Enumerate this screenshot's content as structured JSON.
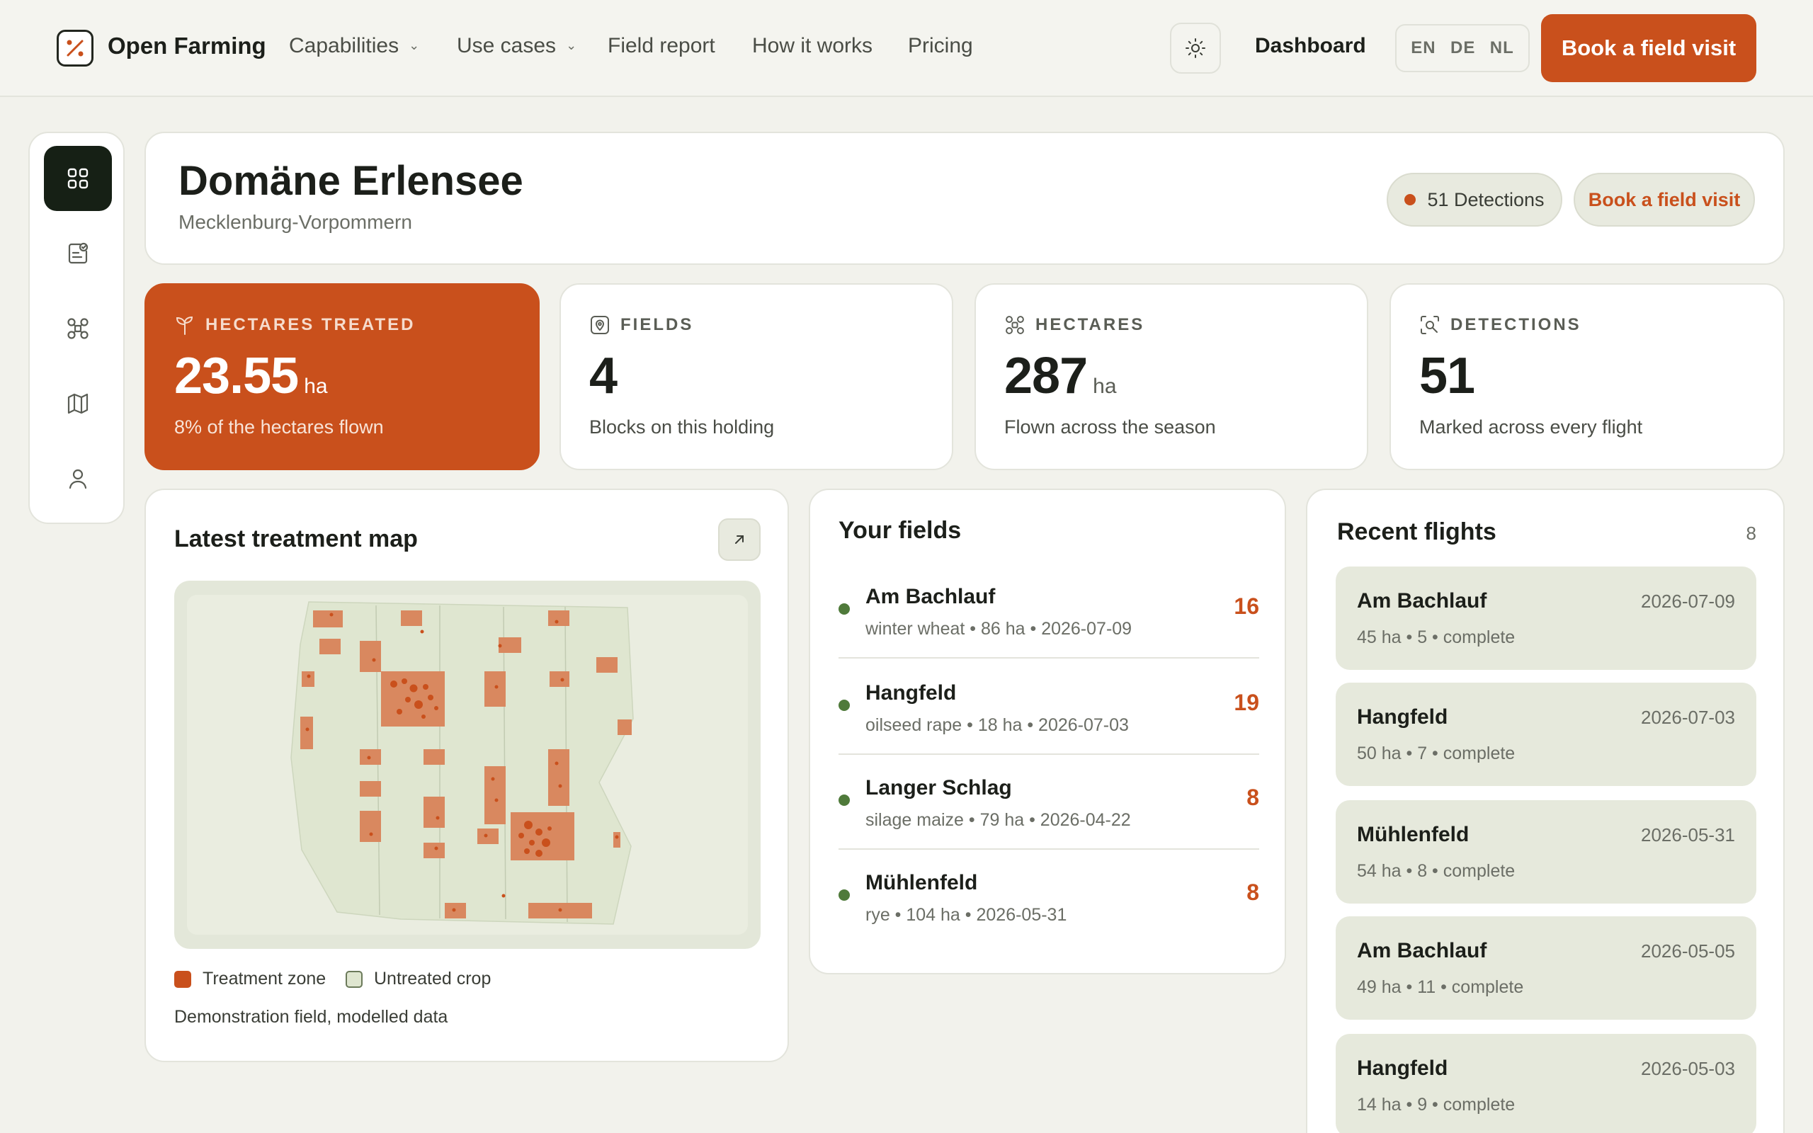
{
  "nav": {
    "brand": "Open Farming",
    "links": [
      {
        "label": "Capabilities",
        "dropdown": true
      },
      {
        "label": "Use cases",
        "dropdown": true
      },
      {
        "label": "Field report",
        "dropdown": false
      },
      {
        "label": "How it works",
        "dropdown": false
      },
      {
        "label": "Pricing",
        "dropdown": false
      }
    ],
    "dashboard": "Dashboard",
    "languages": [
      "EN",
      "DE",
      "NL"
    ],
    "cta": "Book a field visit"
  },
  "sidebar": {
    "items": [
      {
        "icon": "grid-icon",
        "active": true
      },
      {
        "icon": "report-icon",
        "active": false
      },
      {
        "icon": "drone-icon",
        "active": false
      },
      {
        "icon": "map-icon",
        "active": false
      },
      {
        "icon": "user-icon",
        "active": false
      }
    ]
  },
  "header": {
    "farm_name": "Domäne Erlensee",
    "region": "Mecklenburg-Vorpommern",
    "detections_pill": "51 Detections",
    "cta": "Book a field visit"
  },
  "stats": [
    {
      "label": "HECTARES TREATED",
      "value": "23.55",
      "unit": "ha",
      "sub": "8% of the hectares flown",
      "icon": "sprout-icon"
    },
    {
      "label": "FIELDS",
      "value": "4",
      "unit": "",
      "sub": "Blocks on this holding",
      "icon": "field-pin-icon"
    },
    {
      "label": "HECTARES",
      "value": "287",
      "unit": "ha",
      "sub": "Flown across the season",
      "icon": "drone-icon"
    },
    {
      "label": "DETECTIONS",
      "value": "51",
      "unit": "",
      "sub": "Marked across every flight",
      "icon": "scan-icon"
    }
  ],
  "map": {
    "title": "Latest treatment map",
    "legend": [
      {
        "label": "Treatment zone",
        "color": "#d9885f"
      },
      {
        "label": "Untreated crop",
        "color": "#dfe6d0"
      }
    ],
    "note": "Demonstration field, modelled data"
  },
  "fields": {
    "title": "Your fields",
    "items": [
      {
        "name": "Am Bachlauf",
        "meta": "winter wheat • 86 ha • 2026-07-09",
        "count": "16"
      },
      {
        "name": "Hangfeld",
        "meta": "oilseed rape • 18 ha • 2026-07-03",
        "count": "19"
      },
      {
        "name": "Langer Schlag",
        "meta": "silage maize • 79 ha • 2026-04-22",
        "count": "8"
      },
      {
        "name": "Mühlenfeld",
        "meta": "rye • 104 ha • 2026-05-31",
        "count": "8"
      }
    ]
  },
  "flights": {
    "title": "Recent flights",
    "count": "8",
    "items": [
      {
        "name": "Am Bachlauf",
        "date": "2026-07-09",
        "meta": "45 ha • 5 • complete"
      },
      {
        "name": "Hangfeld",
        "date": "2026-07-03",
        "meta": "50 ha • 7 • complete"
      },
      {
        "name": "Mühlenfeld",
        "date": "2026-05-31",
        "meta": "54 ha • 8 • complete"
      },
      {
        "name": "Am Bachlauf",
        "date": "2026-05-05",
        "meta": "49 ha • 11 • complete"
      },
      {
        "name": "Hangfeld",
        "date": "2026-05-03",
        "meta": "14 ha • 9 • complete"
      }
    ]
  },
  "colors": {
    "accent": "#c9501c",
    "field_dot": "#4f7a3a",
    "sidebar_active": "#162015"
  }
}
